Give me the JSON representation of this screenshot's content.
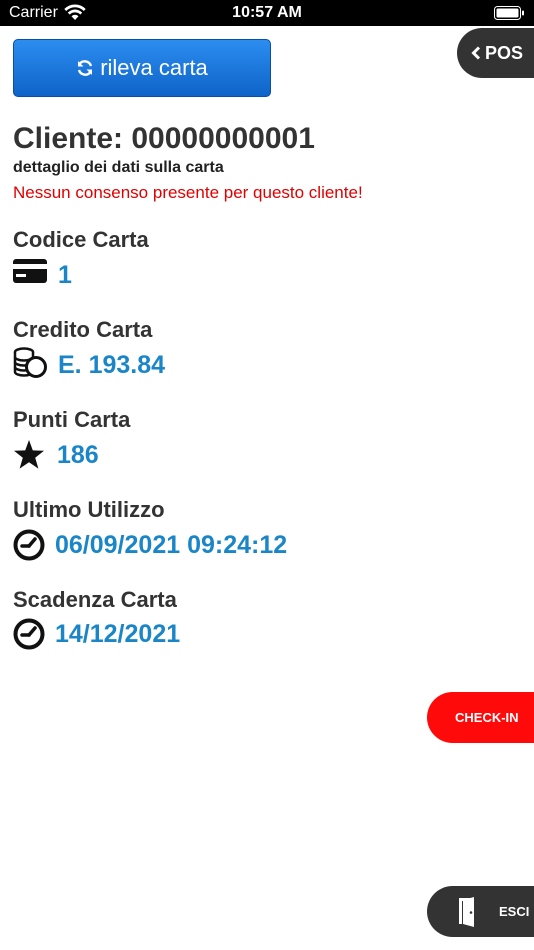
{
  "status_bar": {
    "carrier": "Carrier",
    "time": "10:57 AM"
  },
  "toolbar": {
    "detect_label": "rileva carta",
    "pos_label": "POS"
  },
  "client": {
    "title": "Cliente: 00000000001",
    "subtitle": "dettaglio dei dati sulla carta",
    "warning": "Nessun consenso presente per questo cliente!"
  },
  "fields": [
    {
      "label": "Codice Carta",
      "value": "1",
      "icon": "credit-card-icon"
    },
    {
      "label": "Credito Carta",
      "value": "E. 193.84",
      "icon": "coins-icon"
    },
    {
      "label": "Punti Carta",
      "value": "186",
      "icon": "star-icon"
    },
    {
      "label": "Ultimo Utilizzo",
      "value": "06/09/2021 09:24:12",
      "icon": "clock-icon"
    },
    {
      "label": "Scadenza Carta",
      "value": "14/12/2021",
      "icon": "clock-icon"
    }
  ],
  "actions": {
    "checkin_label": "CHECK-IN",
    "exit_label": "ESCI"
  },
  "colors": {
    "primary_blue": "#1a86c8",
    "button_blue": "#1a75dc",
    "warning_red": "#e00000",
    "checkin_red": "#ff0a0a",
    "dark_pill": "#333333"
  }
}
